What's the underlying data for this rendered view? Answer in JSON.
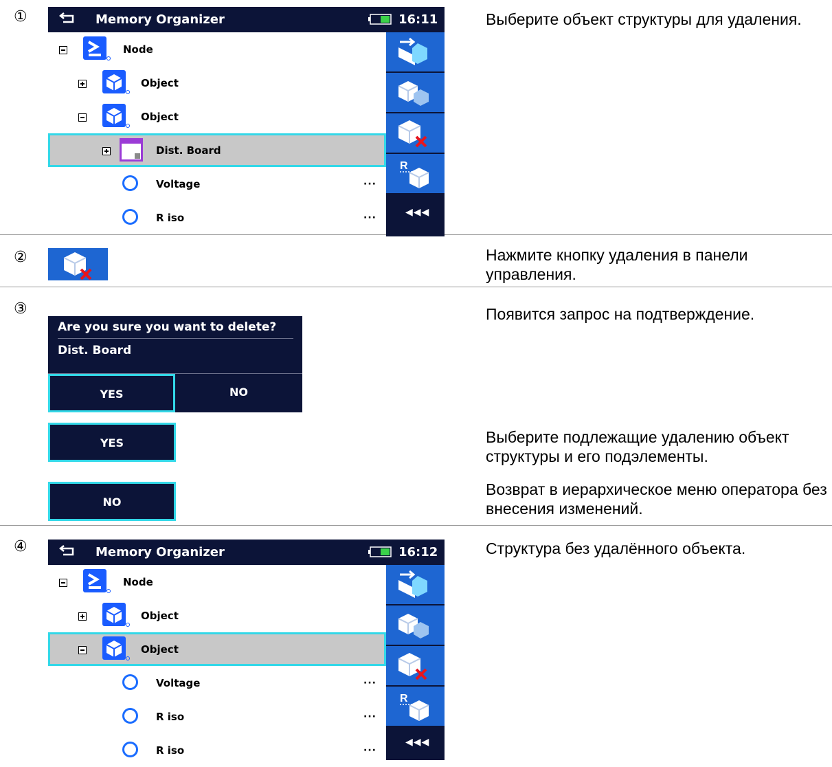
{
  "steps": [
    {
      "number": "①",
      "description": "Выберите объект структуры для удаления."
    },
    {
      "number": "②",
      "description": "Нажмите кнопку удаления в панели управления."
    },
    {
      "number": "③",
      "description": "Появится запрос на подтверждение."
    },
    {
      "number": "④",
      "description": "Структура без удалённого объекта."
    }
  ],
  "yes_description": "Выберите подлежащие удалению объект структуры и его подэлементы.",
  "no_description": "Возврат в иерархическое меню оператора без внесения изменений.",
  "screen1": {
    "title": "Memory Organizer",
    "time": "16:11",
    "rows": [
      "Node",
      "Object",
      "Object",
      "Dist. Board",
      "Voltage",
      "R iso"
    ],
    "dots": "···"
  },
  "dialog": {
    "question": "Are you sure you want to delete?",
    "item": "Dist. Board",
    "yes": "YES",
    "no": "NO"
  },
  "buttons": {
    "yes": "YES",
    "no": "NO"
  },
  "screen2": {
    "title": "Memory Organizer",
    "time": "16:12",
    "rows": [
      "Node",
      "Object",
      "Object",
      "Voltage",
      "R iso",
      "R iso"
    ],
    "dots": "···"
  },
  "toolbar": {
    "more": "◀◀◀"
  },
  "colors": {
    "dark": "#0c1438",
    "blue": "#1e66d2",
    "highlight": "#33d8e8",
    "selected": "#c8c8c8"
  }
}
